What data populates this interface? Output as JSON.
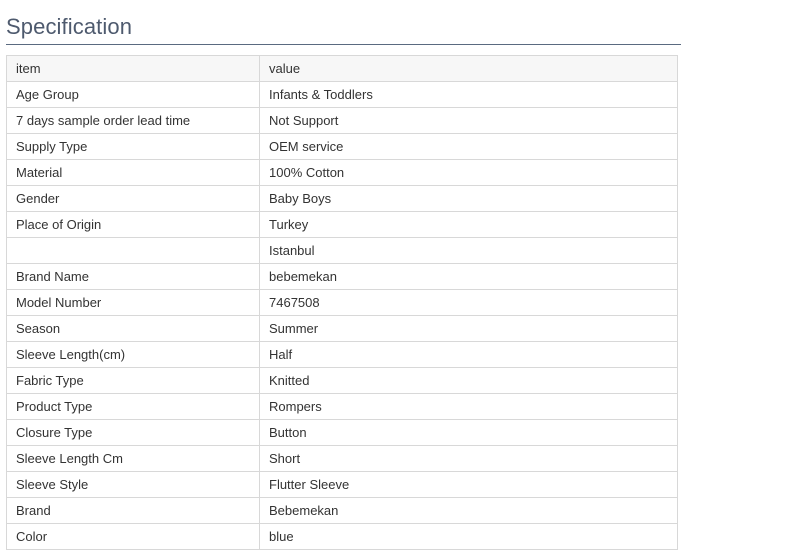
{
  "section": {
    "title": "Specification"
  },
  "table": {
    "headers": [
      "item",
      "value"
    ],
    "rows": [
      [
        "Age Group",
        "Infants & Toddlers"
      ],
      [
        "7 days sample order lead time",
        "Not Support"
      ],
      [
        "Supply Type",
        "OEM service"
      ],
      [
        "Material",
        "100% Cotton"
      ],
      [
        "Gender",
        "Baby Boys"
      ],
      [
        "Place of Origin",
        "Turkey"
      ],
      [
        "",
        "Istanbul"
      ],
      [
        "Brand Name",
        "bebemekan"
      ],
      [
        "Model Number",
        "7467508"
      ],
      [
        "Season",
        "Summer"
      ],
      [
        "Sleeve Length(cm)",
        "Half"
      ],
      [
        "Fabric Type",
        "Knitted"
      ],
      [
        "Product Type",
        "Rompers"
      ],
      [
        "Closure Type",
        "Button"
      ],
      [
        "Sleeve Length Cm",
        "Short"
      ],
      [
        "Sleeve Style",
        "Flutter Sleeve"
      ],
      [
        "Brand",
        "Bebemekan"
      ],
      [
        "Color",
        "blue"
      ]
    ]
  }
}
